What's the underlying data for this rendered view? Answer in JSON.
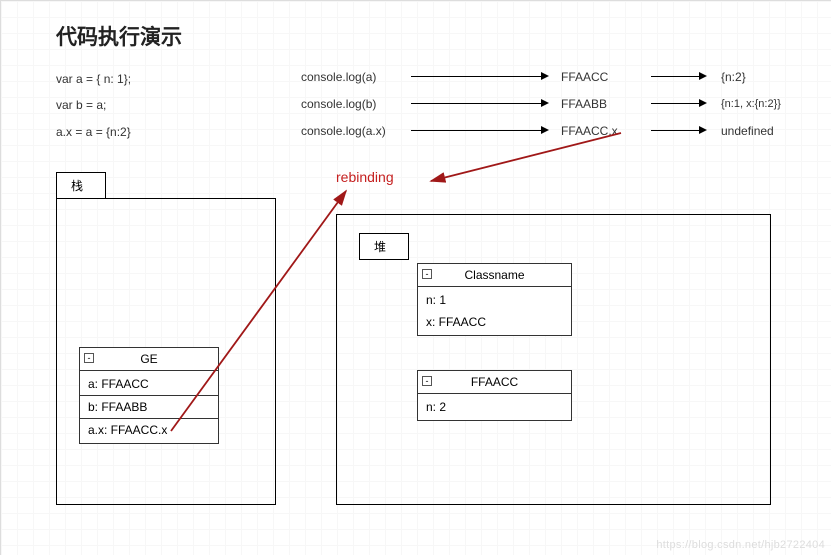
{
  "title": "代码执行演示",
  "code": {
    "l1": "var a = { n: 1};",
    "l2": "var b = a;",
    "l3": "a.x = a = {n:2}"
  },
  "log": {
    "r1": {
      "call": "console.log(a)",
      "mid": "FFAACC",
      "out": "{n:2}"
    },
    "r2": {
      "call": "console.log(b)",
      "mid": "FFAABB",
      "out": "{n:1, x:{n:2}}"
    },
    "r3": {
      "call": "console.log(a.x)",
      "mid": "FFAACC.x",
      "out": "undefined"
    }
  },
  "rebinding_label": "rebinding",
  "stack": {
    "tab": "栈",
    "ge": {
      "name": "GE",
      "rows": {
        "a": "a: FFAACC",
        "b": "b: FFAABB",
        "ax": "a.x: FFAACC.x"
      }
    }
  },
  "heap": {
    "tab": "堆",
    "classname": {
      "name": "Classname",
      "rows": {
        "n": "n: 1",
        "x": "x: FFAACC"
      }
    },
    "ffaacc": {
      "name": "FFAACC",
      "rows": {
        "n": "n: 2"
      }
    }
  },
  "collapse_glyph": "-",
  "watermark": "https://blog.csdn.net/hjb2722404"
}
